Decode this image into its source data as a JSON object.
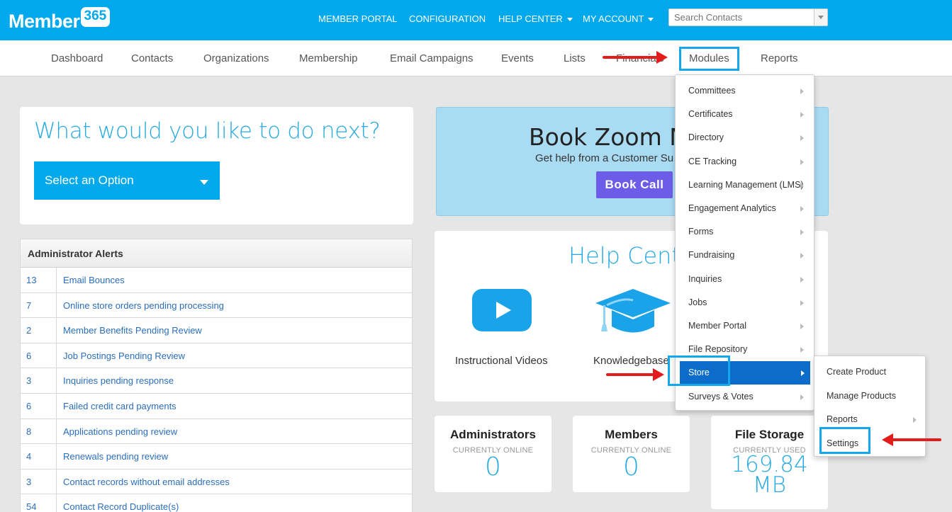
{
  "logo": {
    "text": "Member",
    "badge": "365"
  },
  "topnav": {
    "items": [
      {
        "label": "MEMBER PORTAL",
        "has_caret": false
      },
      {
        "label": "CONFIGURATION",
        "has_caret": false
      },
      {
        "label": "HELP CENTER",
        "has_caret": true
      },
      {
        "label": "MY ACCOUNT",
        "has_caret": true
      }
    ],
    "search_placeholder": "Search Contacts"
  },
  "mainnav": {
    "items": [
      "Dashboard",
      "Contacts",
      "Organizations",
      "Membership",
      "Email Campaigns",
      "Events",
      "Lists",
      "Financials",
      "Modules",
      "Reports"
    ],
    "active": "Modules"
  },
  "next": {
    "title": "What would you like to do next?",
    "select_label": "Select an Option"
  },
  "alerts": {
    "title": "Administrator Alerts",
    "rows": [
      {
        "count": "13",
        "label": "Email Bounces"
      },
      {
        "count": "7",
        "label": "Online store orders pending processing"
      },
      {
        "count": "2",
        "label": "Member Benefits Pending Review"
      },
      {
        "count": "6",
        "label": "Job Postings Pending Review"
      },
      {
        "count": "3",
        "label": "Inquiries pending response"
      },
      {
        "count": "6",
        "label": "Failed credit card payments"
      },
      {
        "count": "8",
        "label": "Applications pending review"
      },
      {
        "count": "4",
        "label": "Renewals pending review"
      },
      {
        "count": "3",
        "label": "Contact records without email addresses"
      },
      {
        "count": "54",
        "label": "Contact Record Duplicate(s)"
      }
    ]
  },
  "zoom": {
    "title": "Book Zoom M",
    "subtitle": "Get help from a Customer Su",
    "button": "Book Call"
  },
  "help": {
    "title": "Help Cente",
    "video_label": "Instructional Videos",
    "kb_label": "Knowledgebase"
  },
  "stats": [
    {
      "title": "Administrators",
      "sub": "CURRENTLY ONLINE",
      "value": "0"
    },
    {
      "title": "Members",
      "sub": "CURRENTLY ONLINE",
      "value": "0"
    },
    {
      "title": "File Storage",
      "sub": "CURRENTLY USED",
      "value_num": "169.84",
      "value_unit": "MB"
    }
  ],
  "modules_menu": {
    "items": [
      "Committees",
      "Certificates",
      "Directory",
      "CE Tracking",
      "Learning Management (LMS)",
      "Engagement Analytics",
      "Forms",
      "Fundraising",
      "Inquiries",
      "Jobs",
      "Member Portal",
      "File Repository",
      "Store",
      "Surveys & Votes"
    ],
    "active": "Store"
  },
  "store_submenu": {
    "items": [
      {
        "label": "Create Product",
        "has_sub": false
      },
      {
        "label": "Manage Products",
        "has_sub": false
      },
      {
        "label": "Reports",
        "has_sub": true
      },
      {
        "label": "Settings",
        "has_sub": false
      }
    ]
  },
  "colors": {
    "brand": "#00a8ec",
    "link": "#2a6ebb",
    "accent_text": "#27aae1",
    "highlight": "#0b6dc9",
    "annotation": "#e21b1b",
    "book_button": "#6c5ce7"
  }
}
